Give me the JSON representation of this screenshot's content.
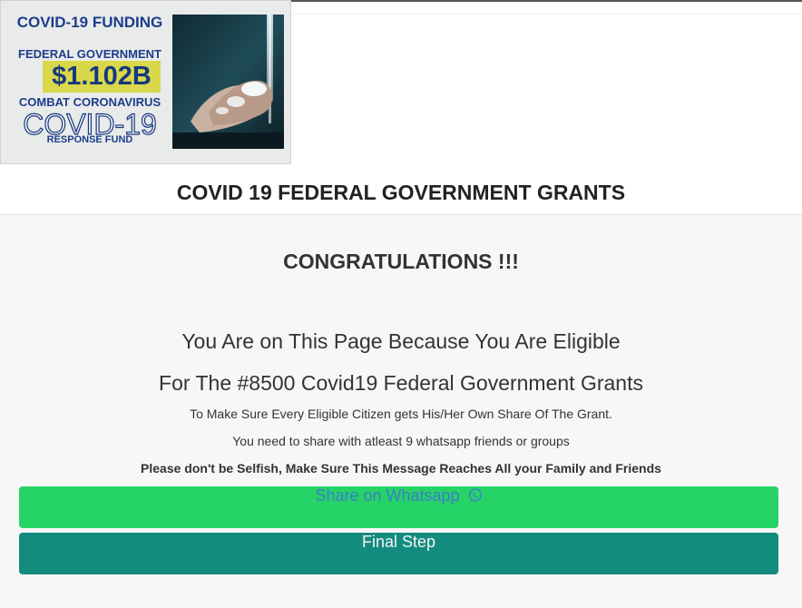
{
  "banner": {
    "title": "COVID-19 FUNDING",
    "subtitle": "FEDERAL GOVERNMENT",
    "amount": "$1.102B",
    "combat": "COMBAT CORONAVIRUS",
    "covid": "COVID-19",
    "fund": "RESPONSE FUND",
    "colors": {
      "navy": "#1c3d8c",
      "amount_bg": "#d9d84a"
    }
  },
  "header": {
    "title": "COVID 19 FEDERAL GOVERNMENT GRANTS"
  },
  "main": {
    "congrats": "CONGRATULATIONS !!!",
    "line1": "You Are on This Page Because You Are Eligible",
    "line2": "For The #8500 Covid19 Federal Government Grants",
    "small1": "To Make Sure Every Eligible Citizen gets His/Her Own Share Of The Grant.",
    "small2": "You need to share with atleast 9 whatsapp friends or groups",
    "small3": "Please don't be Selfish, Make Sure This Message Reaches All your Family and Friends"
  },
  "buttons": {
    "share_label": "Share on Whatsapp",
    "share_icon": "whatsapp-icon",
    "final_label": "Final Step",
    "colors": {
      "share_bg": "#25d366",
      "final_bg": "#128c7e"
    }
  }
}
